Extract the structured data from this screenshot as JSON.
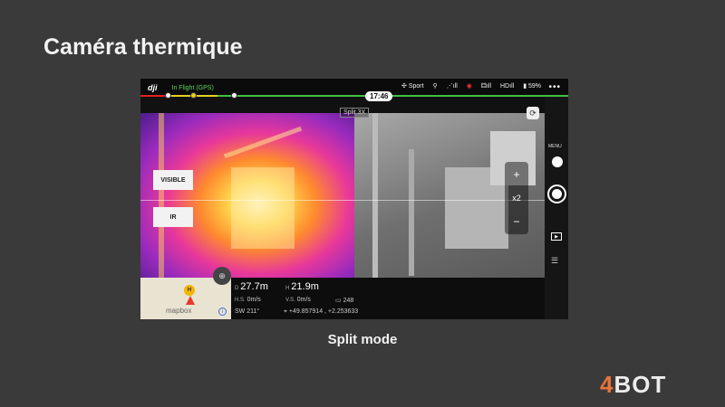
{
  "slide": {
    "title": "Caméra thermique",
    "caption": "Split mode",
    "brand_prefix": "4",
    "brand_suffix": "BOT"
  },
  "app": {
    "logo": "dji",
    "flight_status": "In Flight (GPS)",
    "flight_mode": "Sport",
    "hd_label": "HD",
    "battery": "59%",
    "time": "17:46",
    "camera_mode": "Split 3X",
    "menu_label": "MENU",
    "zoom_in": "+",
    "zoom_level": "x2",
    "zoom_out": "−",
    "buttons": {
      "visible": "VISIBLE",
      "ir": "IR"
    },
    "map_label": "mapbox",
    "icons": {
      "mode": "drone-icon",
      "wind": "wind-icon",
      "rc": "remote-icon",
      "gps": "gps-icon",
      "more": "more-icon"
    }
  },
  "telemetry": {
    "d_label": "D",
    "d_value": "27.7m",
    "h_label": "H",
    "h_value": "21.9m",
    "hs_label": "H.S.",
    "hs_value": "0m/s",
    "vs_label": "V.S.",
    "vs_value": "0m/s",
    "sw_label": "SW",
    "sw_value": "211°",
    "sat_count": "248",
    "coords": "+49.857914 , +2.253633"
  },
  "colors": {
    "flight_ok": "#5fd35f",
    "brand_accent": "#e8743b",
    "background": "#3a3a3a"
  }
}
